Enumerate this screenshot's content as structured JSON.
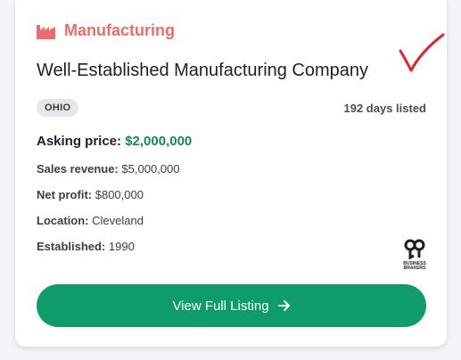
{
  "listing": {
    "category": "Manufacturing",
    "title": "Well-Established Manufacturing Company",
    "state_badge": "OHIO",
    "days_listed": "192 days listed",
    "asking_price_label": "Asking price:",
    "asking_price_value": "$2,000,000",
    "details": [
      {
        "label": "Sales revenue:",
        "value": "$5,000,000"
      },
      {
        "label": "Net profit:",
        "value": "$800,000"
      },
      {
        "label": "Location:",
        "value": "Cleveland"
      },
      {
        "label": "Established:",
        "value": "1990"
      }
    ],
    "broker_logo_text": "BUSINESS BRAKERS",
    "cta_label": "View Full Listing"
  },
  "colors": {
    "category": "#ef6b6b",
    "price": "#0f8a5f",
    "cta_background": "#0e9c6b",
    "annotation_mark": "#e0262a"
  },
  "icons": {
    "category": "factory-icon",
    "cta": "arrow-right-icon",
    "annotation": "checkmark-icon"
  }
}
